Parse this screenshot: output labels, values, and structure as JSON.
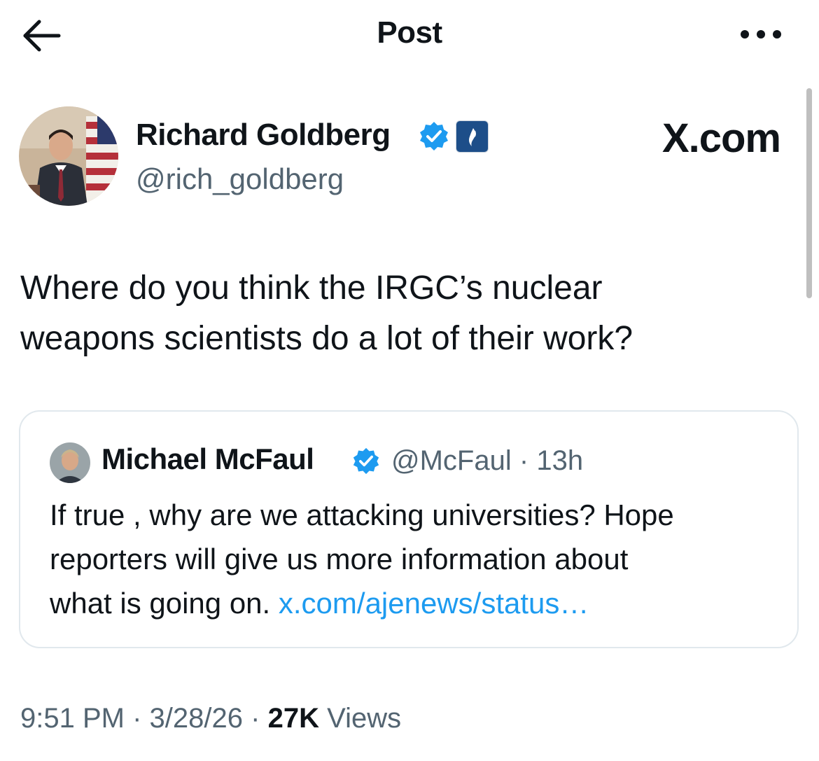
{
  "header": {
    "title": "Post"
  },
  "author": {
    "name": "Richard Goldberg",
    "handle": "@rich_goldberg"
  },
  "brand_label": "X.com",
  "post": {
    "text_line1": "Where do you think the IRGC’s nuclear",
    "text_line2": "weapons scientists do a lot of their work?"
  },
  "quoted_post": {
    "author_name": "Michael McFaul",
    "handle": "@McFaul",
    "separator": "·",
    "age": "13h",
    "text_line1": "If true , why are we attacking universities? Hope",
    "text_line2": "reporters will give us more information about",
    "text_line3": "what is going on.",
    "link_text": "x.com/ajenews/status…"
  },
  "footer": {
    "time": "9:51 PM",
    "date": "3/28/26",
    "separator": "·",
    "views_count": "27K",
    "views_label": "Views"
  },
  "icons": {
    "back": "arrow-left-icon",
    "more": "ellipsis-icon",
    "verified": "verified-check-icon",
    "affiliation": "affiliation-badge-icon"
  },
  "colors": {
    "text": "#0f1419",
    "secondary": "#536471",
    "link": "#1d9bf0",
    "verified": "#1d9bf0",
    "border": "#e1e8ed"
  }
}
